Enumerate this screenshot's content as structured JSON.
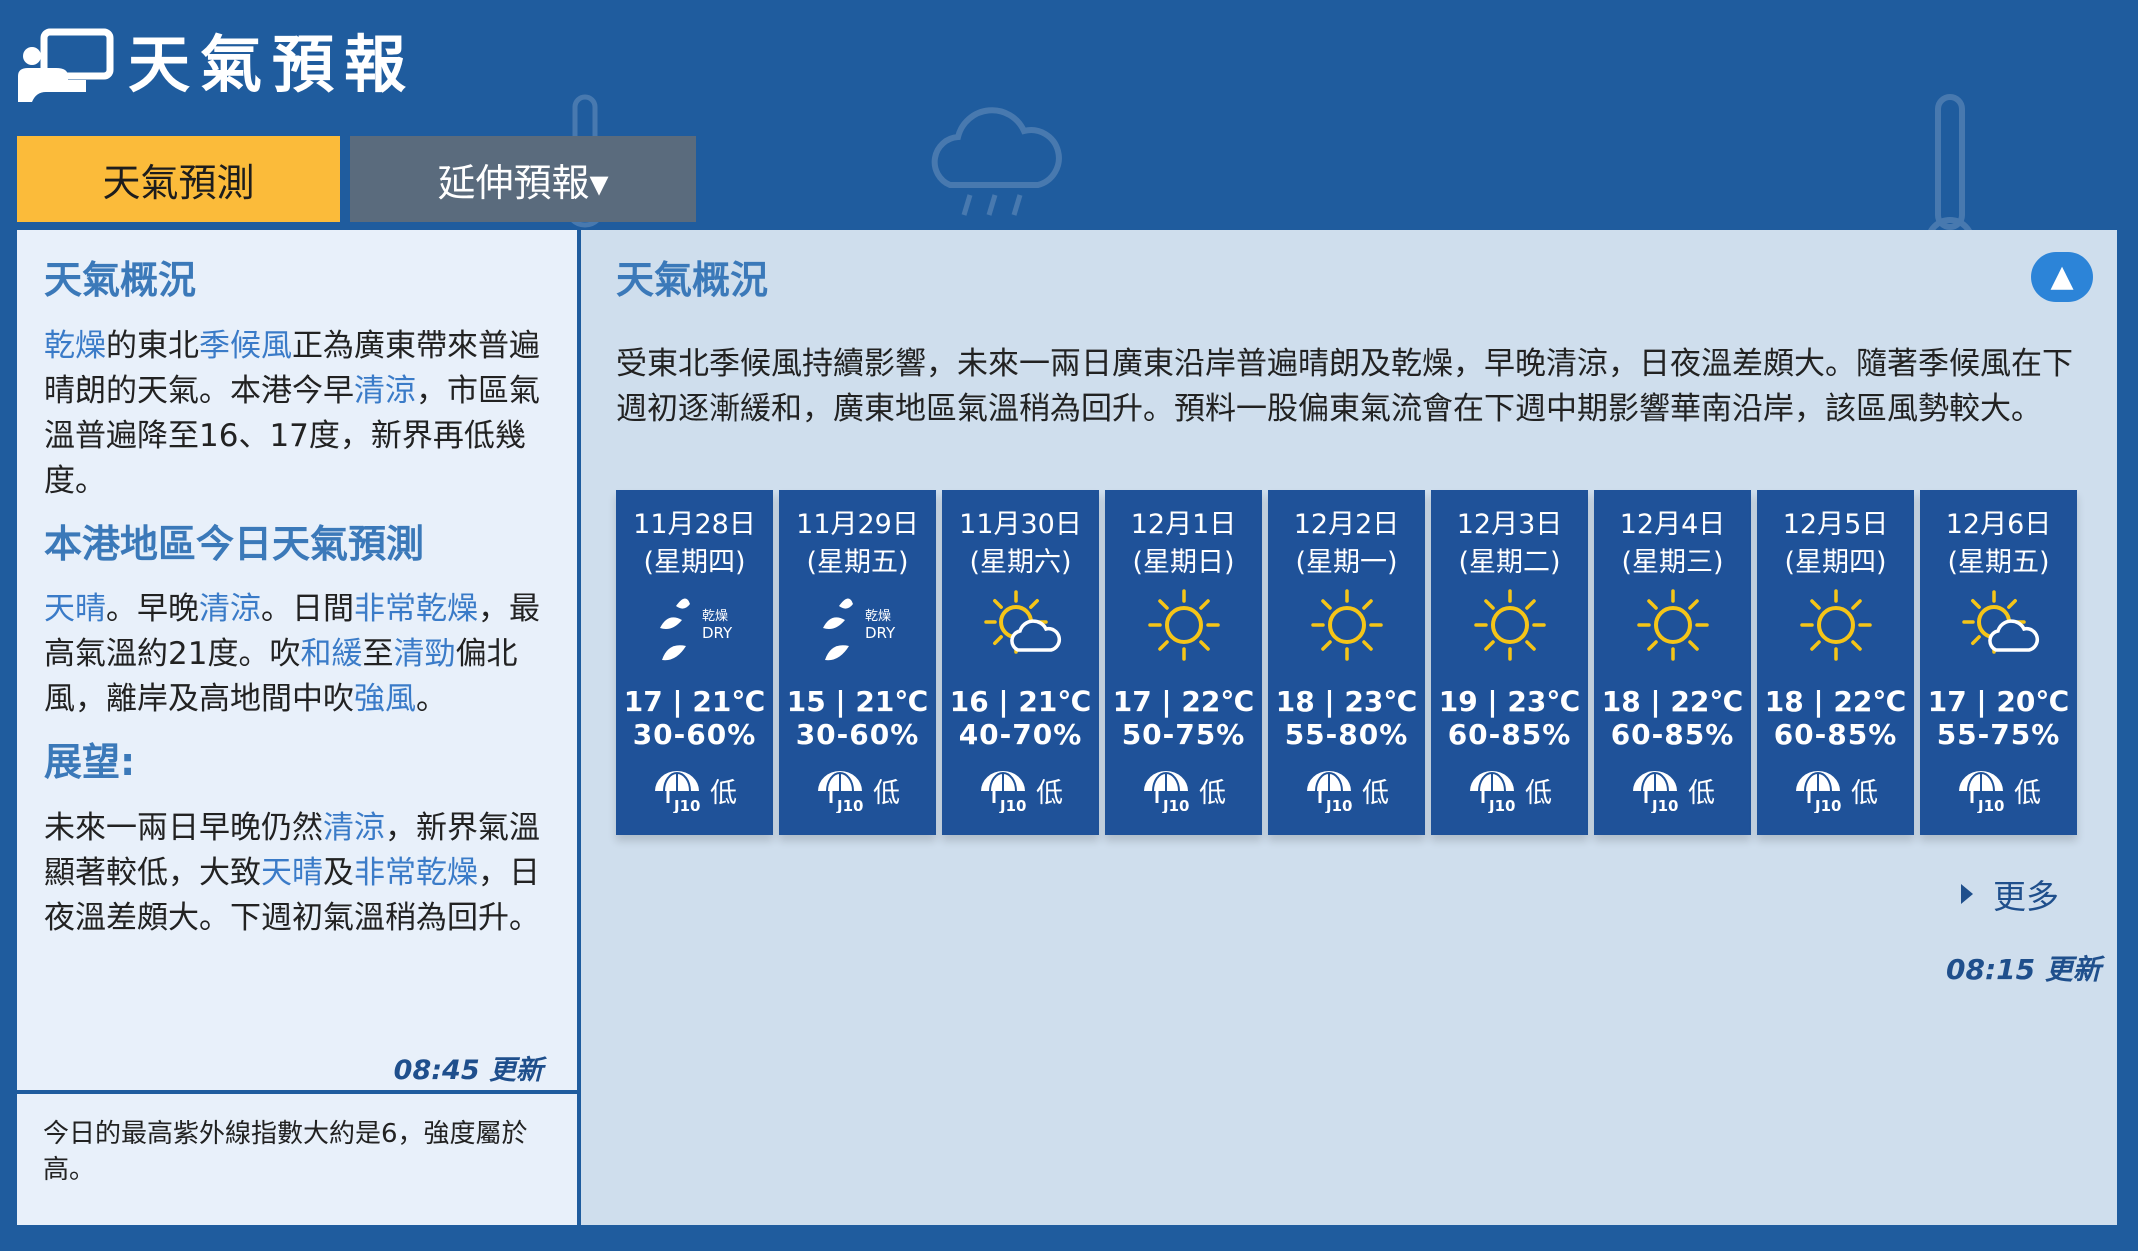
{
  "header": {
    "title": "天氣預報",
    "logo_icon": "hand-weather-logo-icon"
  },
  "tabs": [
    {
      "label": "天氣預測",
      "active": true
    },
    {
      "label": "延伸預報▾",
      "active": false
    }
  ],
  "left": {
    "heading1": "天氣概況",
    "para1": [
      {
        "t": "乾燥",
        "h": true
      },
      {
        "t": "的東北",
        "h": false
      },
      {
        "t": "季候風",
        "h": true
      },
      {
        "t": "正為廣東帶來普遍晴朗的天氣。本港今早",
        "h": false
      },
      {
        "t": "清涼",
        "h": true
      },
      {
        "t": "，市區氣溫普遍降至16、17度，新界再低幾度。",
        "h": false
      }
    ],
    "heading2": "本港地區今日天氣預測",
    "para2": [
      {
        "t": "天晴",
        "h": true
      },
      {
        "t": "。早晚",
        "h": false
      },
      {
        "t": "清涼",
        "h": true
      },
      {
        "t": "。日間",
        "h": false
      },
      {
        "t": "非常乾燥",
        "h": true
      },
      {
        "t": "，最高氣溫約21度。吹",
        "h": false
      },
      {
        "t": "和緩",
        "h": true
      },
      {
        "t": "至",
        "h": false
      },
      {
        "t": "清勁",
        "h": true
      },
      {
        "t": "偏北風，離岸及高地間中吹",
        "h": false
      },
      {
        "t": "強風",
        "h": true
      },
      {
        "t": "。",
        "h": false
      }
    ],
    "heading3": "展望:",
    "para3": [
      {
        "t": "未來一兩日早晚仍然",
        "h": false
      },
      {
        "t": "清涼",
        "h": true
      },
      {
        "t": "，新界氣溫顯著較低，大致",
        "h": false
      },
      {
        "t": "天晴",
        "h": true
      },
      {
        "t": "及",
        "h": false
      },
      {
        "t": "非常乾燥",
        "h": true
      },
      {
        "t": "，日夜溫差頗大。下週初氣溫稍為回升。",
        "h": false
      }
    ],
    "update": "08:45 更新",
    "uv_text": "今日的最高紫外線指數大約是6，強度屬於高。"
  },
  "right": {
    "heading": "天氣概況",
    "collapse_icon": "▲",
    "general": "受東北季候風持續影響，未來一兩日廣東沿岸普遍晴朗及乾燥，早晚清涼，日夜溫差頗大。隨著季候風在下週初逐漸緩和，廣東地區氣溫稍為回升。預料一股偏東氣流會在下週中期影響華南沿岸，該區風勢較大。",
    "more": "更多",
    "update": "08:15 更新"
  },
  "forecast": [
    {
      "date": "11月28日",
      "week": "(星期四)",
      "icon": "dry-icon",
      "temp": "17 | 21℃",
      "rh": "30-60%",
      "psr": "低"
    },
    {
      "date": "11月29日",
      "week": "(星期五)",
      "icon": "dry-icon",
      "temp": "15 | 21℃",
      "rh": "30-60%",
      "psr": "低"
    },
    {
      "date": "11月30日",
      "week": "(星期六)",
      "icon": "sunny-periods-icon",
      "temp": "16 | 21℃",
      "rh": "40-70%",
      "psr": "低"
    },
    {
      "date": "12月1日",
      "week": "(星期日)",
      "icon": "sunny-icon",
      "temp": "17 | 22℃",
      "rh": "50-75%",
      "psr": "低"
    },
    {
      "date": "12月2日",
      "week": "(星期一)",
      "icon": "sunny-icon",
      "temp": "18 | 23℃",
      "rh": "55-80%",
      "psr": "低"
    },
    {
      "date": "12月3日",
      "week": "(星期二)",
      "icon": "sunny-icon",
      "temp": "19 | 23℃",
      "rh": "60-85%",
      "psr": "低"
    },
    {
      "date": "12月4日",
      "week": "(星期三)",
      "icon": "sunny-icon",
      "temp": "18 | 22℃",
      "rh": "60-85%",
      "psr": "低"
    },
    {
      "date": "12月5日",
      "week": "(星期四)",
      "icon": "sunny-icon",
      "temp": "18 | 22℃",
      "rh": "60-85%",
      "psr": "低"
    },
    {
      "date": "12月6日",
      "week": "(星期五)",
      "icon": "sunny-periods-icon",
      "temp": "17 | 20℃",
      "rh": "55-75%",
      "psr": "低"
    }
  ],
  "icon_text": {
    "dry_zh": "乾燥",
    "dry_en": "DRY",
    "umbrella_label": "J10"
  },
  "colors": {
    "background": "#1f5c9e",
    "tab_active": "#fbbb3a",
    "tab_inactive": "#5a6b7d",
    "card": "#1f5299",
    "highlight": "#3a7bc8",
    "sun": "#f5c518"
  }
}
